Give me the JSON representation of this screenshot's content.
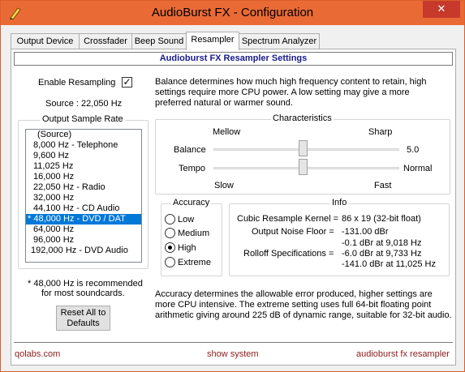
{
  "window": {
    "title": "AudioBurst FX - Configuration",
    "close_glyph": "✕",
    "app_icon": "pen-icon"
  },
  "tabs": [
    {
      "label": "Output Device"
    },
    {
      "label": "Crossfader"
    },
    {
      "label": "Beep Sound"
    },
    {
      "label": "Resampler",
      "active": true
    },
    {
      "label": "Spectrum Analyzer"
    }
  ],
  "header": "Audioburst FX Resampler Settings",
  "enable": {
    "label": "Enable Resampling",
    "checked": "✓"
  },
  "source": "Source : 22,050 Hz",
  "output_rate": {
    "legend": "Output Sample Rate",
    "items": [
      "(Source)",
      "8,000 Hz - Telephone",
      "9,600 Hz",
      "11,025 Hz",
      "16,000 Hz",
      "22,050 Hz - Radio",
      "32,000 Hz",
      "44,100 Hz - CD Audio",
      "* 48,000 Hz - DVD / DAT",
      "64,000 Hz",
      "96,000 Hz",
      "192,000 Hz - DVD Audio"
    ],
    "selected_index": 8
  },
  "recommend": [
    "* 48,000 Hz is recommended",
    "for most soundcards."
  ],
  "reset_button": [
    "Reset All to",
    "Defaults"
  ],
  "balance_desc": [
    "Balance determines how much high frequency content to retain, high",
    "settings require more CPU power.  A low setting may give a more",
    "preferred natural or warmer sound."
  ],
  "characteristics": {
    "legend": "Characteristics",
    "mellow": "Mellow",
    "sharp": "Sharp",
    "balance_label": "Balance",
    "balance_value": "5.0",
    "balance_level": 0.5,
    "tempo_label": "Tempo",
    "tempo_value": "Normal",
    "tempo_level": 0.5,
    "slow": "Slow",
    "fast": "Fast"
  },
  "accuracy": {
    "legend": "Accuracy",
    "options": [
      "Low",
      "Medium",
      "High",
      "Extreme"
    ],
    "selected": "High"
  },
  "info": {
    "legend": "Info",
    "kernel_label": "Cubic Resample Kernel  =",
    "kernel_value": "86 x 19 (32-bit float)",
    "noise_label": "Output Noise Floor  =",
    "noise_value": "-131.00 dBr",
    "rolloff_label": "Rolloff Specifications  =",
    "rolloff_values": [
      "-0.1 dBr at 9,018 Hz",
      "-6.0 dBr at 9,733 Hz",
      "-141.0 dBr at 11,025 Hz"
    ]
  },
  "accuracy_desc": [
    "Accuracy determines the allowable error produced, higher settings are",
    "more CPU intensive.  The extreme setting uses full 64-bit floating point",
    "arithmetic giving around 225 dB of dynamic range, suitable for 32-bit audio."
  ],
  "footer": {
    "left": "qolabs.com",
    "center": "show system",
    "right": "audioburst fx resampler"
  }
}
